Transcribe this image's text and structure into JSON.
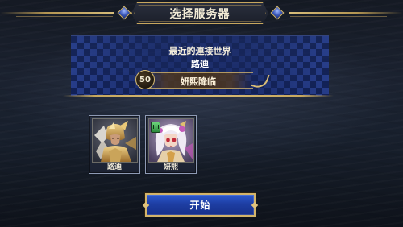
{
  "header": {
    "title": "选择服务器"
  },
  "recent": {
    "label": "最近的連接世界",
    "character_name": "路迪",
    "server_level": "50",
    "server_name": "妍熙降临"
  },
  "characters": [
    {
      "name": "路迪",
      "icon": "paladin-portrait-icon"
    },
    {
      "name": "妍熙",
      "icon": "mage-girl-portrait-icon",
      "badge_icon": "rank-badge-icon"
    }
  ],
  "start_button": {
    "label": "开始"
  },
  "colors": {
    "gold_border": "#c7a75e",
    "button_blue": "#1e3ea3",
    "panel_blue": "#14286e"
  }
}
